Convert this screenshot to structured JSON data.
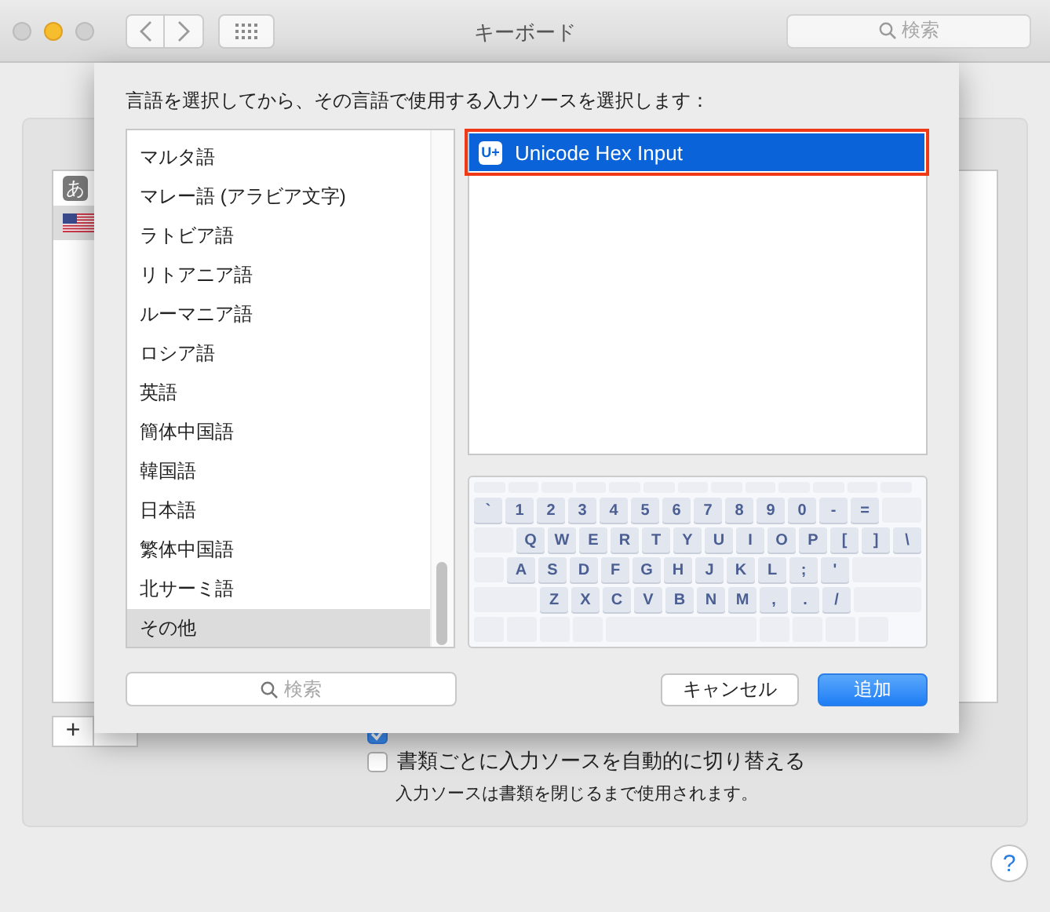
{
  "window": {
    "title": "キーボード",
    "search_placeholder": "検索"
  },
  "panel": {
    "sources": [
      {
        "kind": "glyph",
        "label": "あ",
        "selected": false
      },
      {
        "kind": "flag",
        "selected": true
      }
    ],
    "add_button": "+",
    "checkboxes": [
      {
        "checked": true
      },
      {
        "label": "書類ごとに入力ソースを自動的に切り替える",
        "checked": false
      }
    ],
    "note": "入力ソースは書類を閉じるまで使用されます。",
    "help": "?"
  },
  "sheet": {
    "prompt": "言語を選択してから、その言語で使用する入力ソースを選択します：",
    "languages": [
      {
        "label": "マルタ語",
        "selected": false
      },
      {
        "label": "マレー語 (アラビア文字)",
        "selected": false
      },
      {
        "label": "ラトビア語",
        "selected": false
      },
      {
        "label": "リトアニア語",
        "selected": false
      },
      {
        "label": "ルーマニア語",
        "selected": false
      },
      {
        "label": "ロシア語",
        "selected": false
      },
      {
        "label": "英語",
        "selected": false
      },
      {
        "label": "簡体中国語",
        "selected": false
      },
      {
        "label": "韓国語",
        "selected": false
      },
      {
        "label": "日本語",
        "selected": false
      },
      {
        "label": "繁体中国語",
        "selected": false
      },
      {
        "label": "北サーミ語",
        "selected": false
      },
      {
        "label": "その他",
        "selected": true
      }
    ],
    "input_sources": [
      {
        "icon": "U+",
        "label": "Unicode Hex Input",
        "selected": true,
        "outlined": true
      }
    ],
    "keyboard": {
      "rows": [
        [
          "`",
          "1",
          "2",
          "3",
          "4",
          "5",
          "6",
          "7",
          "8",
          "9",
          "0",
          "-",
          "="
        ],
        [
          "Q",
          "W",
          "E",
          "R",
          "T",
          "Y",
          "U",
          "I",
          "O",
          "P",
          "[",
          "]",
          "\\"
        ],
        [
          "A",
          "S",
          "D",
          "F",
          "G",
          "H",
          "J",
          "K",
          "L",
          ";",
          "'"
        ],
        [
          "Z",
          "X",
          "C",
          "V",
          "B",
          "N",
          "M",
          ",",
          ".",
          "/"
        ]
      ]
    },
    "search_placeholder": "検索",
    "buttons": [
      {
        "label": "キャンセル",
        "kind": "default"
      },
      {
        "label": "追加",
        "kind": "primary"
      }
    ]
  }
}
